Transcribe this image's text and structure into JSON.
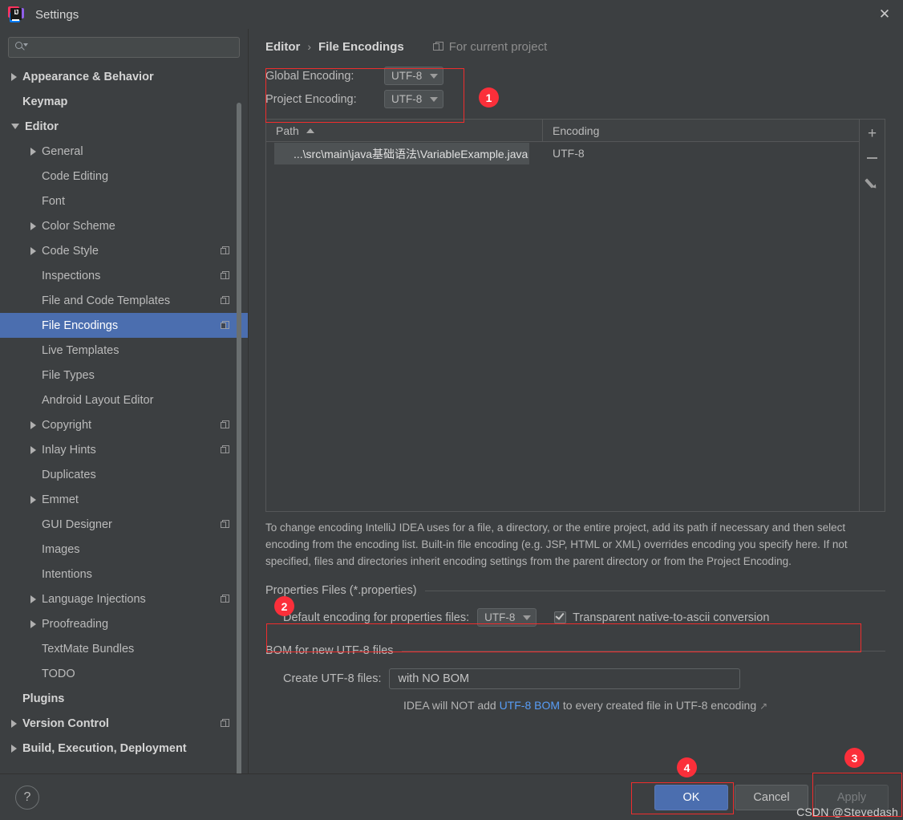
{
  "window": {
    "title": "Settings",
    "close_label": "✕",
    "logo_text": "IJ"
  },
  "search": {
    "placeholder": "",
    "value": "",
    "icon": "search-icon"
  },
  "sidebar": {
    "items": [
      {
        "label": "Appearance & Behavior",
        "indent": 0,
        "arrow": "right",
        "bold": true,
        "badge": false,
        "selected": false
      },
      {
        "label": "Keymap",
        "indent": 0,
        "arrow": "none",
        "bold": true,
        "badge": false,
        "selected": false
      },
      {
        "label": "Editor",
        "indent": 0,
        "arrow": "down",
        "bold": true,
        "badge": false,
        "selected": false
      },
      {
        "label": "General",
        "indent": 1,
        "arrow": "right",
        "bold": false,
        "badge": false,
        "selected": false
      },
      {
        "label": "Code Editing",
        "indent": 1,
        "arrow": "none",
        "bold": false,
        "badge": false,
        "selected": false
      },
      {
        "label": "Font",
        "indent": 1,
        "arrow": "none",
        "bold": false,
        "badge": false,
        "selected": false
      },
      {
        "label": "Color Scheme",
        "indent": 1,
        "arrow": "right",
        "bold": false,
        "badge": false,
        "selected": false
      },
      {
        "label": "Code Style",
        "indent": 1,
        "arrow": "right",
        "bold": false,
        "badge": true,
        "selected": false
      },
      {
        "label": "Inspections",
        "indent": 1,
        "arrow": "none",
        "bold": false,
        "badge": true,
        "selected": false
      },
      {
        "label": "File and Code Templates",
        "indent": 1,
        "arrow": "none",
        "bold": false,
        "badge": true,
        "selected": false
      },
      {
        "label": "File Encodings",
        "indent": 1,
        "arrow": "none",
        "bold": false,
        "badge": true,
        "selected": true
      },
      {
        "label": "Live Templates",
        "indent": 1,
        "arrow": "none",
        "bold": false,
        "badge": false,
        "selected": false
      },
      {
        "label": "File Types",
        "indent": 1,
        "arrow": "none",
        "bold": false,
        "badge": false,
        "selected": false
      },
      {
        "label": "Android Layout Editor",
        "indent": 1,
        "arrow": "none",
        "bold": false,
        "badge": false,
        "selected": false
      },
      {
        "label": "Copyright",
        "indent": 1,
        "arrow": "right",
        "bold": false,
        "badge": true,
        "selected": false
      },
      {
        "label": "Inlay Hints",
        "indent": 1,
        "arrow": "right",
        "bold": false,
        "badge": true,
        "selected": false
      },
      {
        "label": "Duplicates",
        "indent": 1,
        "arrow": "none",
        "bold": false,
        "badge": false,
        "selected": false
      },
      {
        "label": "Emmet",
        "indent": 1,
        "arrow": "right",
        "bold": false,
        "badge": false,
        "selected": false
      },
      {
        "label": "GUI Designer",
        "indent": 1,
        "arrow": "none",
        "bold": false,
        "badge": true,
        "selected": false
      },
      {
        "label": "Images",
        "indent": 1,
        "arrow": "none",
        "bold": false,
        "badge": false,
        "selected": false
      },
      {
        "label": "Intentions",
        "indent": 1,
        "arrow": "none",
        "bold": false,
        "badge": false,
        "selected": false
      },
      {
        "label": "Language Injections",
        "indent": 1,
        "arrow": "right",
        "bold": false,
        "badge": true,
        "selected": false
      },
      {
        "label": "Proofreading",
        "indent": 1,
        "arrow": "right",
        "bold": false,
        "badge": false,
        "selected": false
      },
      {
        "label": "TextMate Bundles",
        "indent": 1,
        "arrow": "none",
        "bold": false,
        "badge": false,
        "selected": false
      },
      {
        "label": "TODO",
        "indent": 1,
        "arrow": "none",
        "bold": false,
        "badge": false,
        "selected": false
      },
      {
        "label": "Plugins",
        "indent": 0,
        "arrow": "none",
        "bold": true,
        "badge": false,
        "selected": false
      },
      {
        "label": "Version Control",
        "indent": 0,
        "arrow": "right",
        "bold": true,
        "badge": true,
        "selected": false
      },
      {
        "label": "Build, Execution, Deployment",
        "indent": 0,
        "arrow": "right",
        "bold": true,
        "badge": false,
        "selected": false
      }
    ]
  },
  "breadcrumb": {
    "parent": "Editor",
    "separator": "›",
    "current": "File Encodings",
    "scope_label": "For current project"
  },
  "encodings": {
    "global_label": "Global Encoding:",
    "global_value": "UTF-8",
    "project_label": "Project Encoding:",
    "project_value": "UTF-8"
  },
  "table": {
    "columns": [
      "Path",
      "Encoding"
    ],
    "sort_column": "Path",
    "sort_direction": "asc",
    "rows": [
      {
        "path": "...\\src\\main\\java基础语法\\VariableExample.java",
        "encoding": "UTF-8"
      }
    ],
    "tooltip": "...\\src\\main\\java基础语法\\VariableExample.java",
    "toolbar": {
      "add": "+",
      "remove": "−",
      "edit": "edit-pencil"
    }
  },
  "description": "To change encoding IntelliJ IDEA uses for a file, a directory, or the entire project, add its path if necessary and then select encoding from the encoding list. Built-in file encoding (e.g. JSP, HTML or XML) overrides encoding you specify here. If not specified, files and directories inherit encoding settings from the parent directory or from the Project Encoding.",
  "properties_section": {
    "title": "Properties Files (*.properties)",
    "default_encoding_label": "Default encoding for properties files:",
    "default_encoding_value": "UTF-8",
    "checkbox_label": "Transparent native-to-ascii conversion",
    "checkbox_checked": true
  },
  "bom_section": {
    "title": "BOM for new UTF-8 files",
    "create_label": "Create UTF-8 files:",
    "create_value": "with NO BOM",
    "note_prefix": "IDEA will NOT add ",
    "note_link": "UTF-8 BOM",
    "note_suffix": " to every created file in UTF-8 encoding",
    "note_external_arrow": "↗"
  },
  "footer": {
    "help_label": "?",
    "ok_label": "OK",
    "cancel_label": "Cancel",
    "apply_label": "Apply"
  },
  "annotations": {
    "markers": [
      "1",
      "2",
      "3",
      "4"
    ]
  },
  "watermark": "CSDN @Stevedash",
  "colors": {
    "accent_blue": "#4b6eaf",
    "annotation_red": "#ef2d2d",
    "marker_red": "#fb2f3a",
    "link_blue": "#589df6",
    "panel_bg": "#3c3f41"
  }
}
